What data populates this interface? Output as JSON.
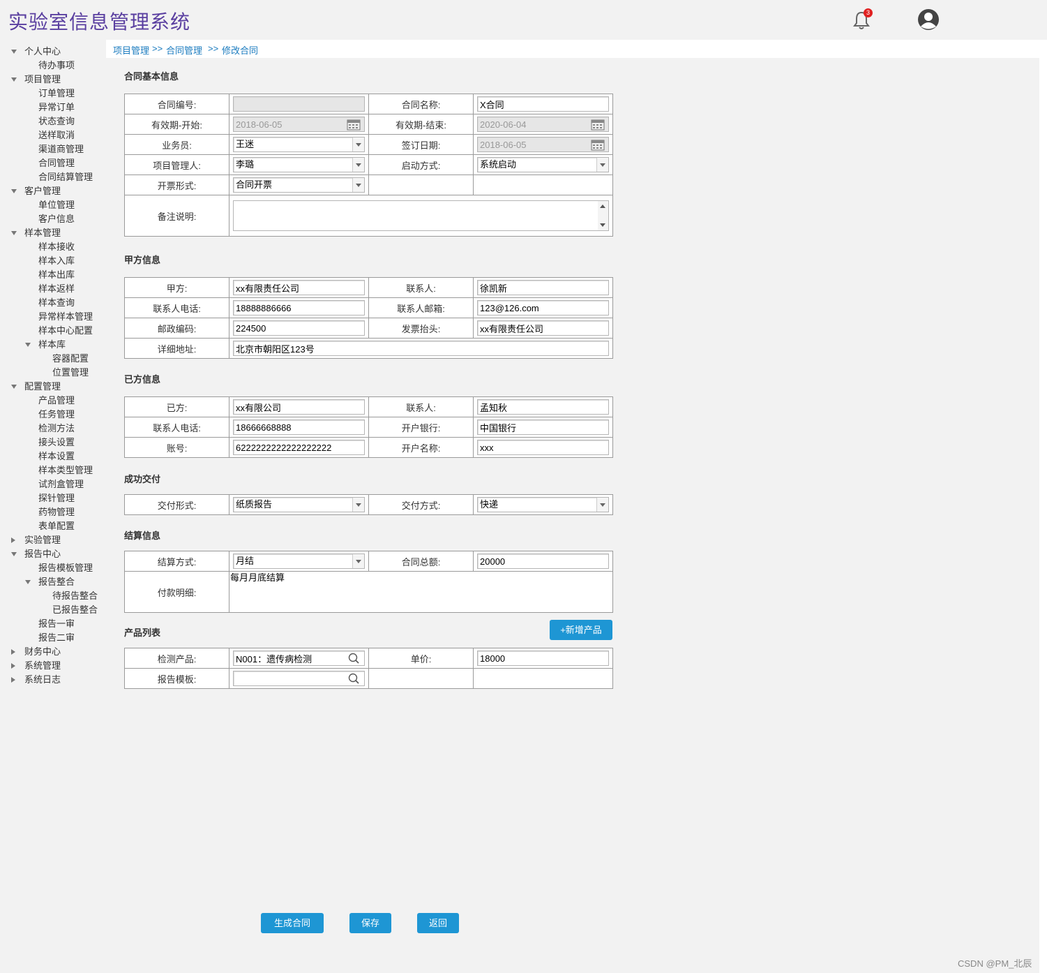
{
  "header": {
    "app_title": "实验室信息管理系统",
    "notification_count": "3"
  },
  "breadcrumb": {
    "items": [
      "项目管理",
      "合同管理",
      "修改合同"
    ],
    "separator": ">>"
  },
  "sidebar": {
    "items": [
      {
        "label": "个人中心",
        "level": 0,
        "state": "expanded"
      },
      {
        "label": "待办事项",
        "level": 1
      },
      {
        "label": "项目管理",
        "level": 0,
        "state": "expanded"
      },
      {
        "label": "订单管理",
        "level": 1
      },
      {
        "label": "异常订单",
        "level": 1
      },
      {
        "label": "状态查询",
        "level": 1
      },
      {
        "label": "送样取消",
        "level": 1
      },
      {
        "label": "渠道商管理",
        "level": 1
      },
      {
        "label": "合同管理",
        "level": 1
      },
      {
        "label": "合同结算管理",
        "level": 1
      },
      {
        "label": "客户管理",
        "level": 0,
        "state": "expanded"
      },
      {
        "label": "单位管理",
        "level": 1
      },
      {
        "label": "客户信息",
        "level": 1
      },
      {
        "label": "样本管理",
        "level": 0,
        "state": "expanded"
      },
      {
        "label": "样本接收",
        "level": 1
      },
      {
        "label": "样本入库",
        "level": 1
      },
      {
        "label": "样本出库",
        "level": 1
      },
      {
        "label": "样本返样",
        "level": 1
      },
      {
        "label": "样本查询",
        "level": 1
      },
      {
        "label": "异常样本管理",
        "level": 1
      },
      {
        "label": "样本中心配置",
        "level": 1
      },
      {
        "label": "样本库",
        "level": 1,
        "state": "expanded"
      },
      {
        "label": "容器配置",
        "level": 2
      },
      {
        "label": "位置管理",
        "level": 2
      },
      {
        "label": "配置管理",
        "level": 0,
        "state": "expanded"
      },
      {
        "label": "产品管理",
        "level": 1
      },
      {
        "label": "任务管理",
        "level": 1
      },
      {
        "label": "检测方法",
        "level": 1
      },
      {
        "label": "接头设置",
        "level": 1
      },
      {
        "label": "样本设置",
        "level": 1
      },
      {
        "label": "样本类型管理",
        "level": 1
      },
      {
        "label": "试剂盒管理",
        "level": 1
      },
      {
        "label": "探针管理",
        "level": 1
      },
      {
        "label": "药物管理",
        "level": 1
      },
      {
        "label": "表单配置",
        "level": 1
      },
      {
        "label": "实验管理",
        "level": 0,
        "state": "collapsed"
      },
      {
        "label": "报告中心",
        "level": 0,
        "state": "expanded"
      },
      {
        "label": "报告模板管理",
        "level": 1
      },
      {
        "label": "报告整合",
        "level": 1,
        "state": "expanded"
      },
      {
        "label": "待报告整合",
        "level": 2
      },
      {
        "label": "已报告整合",
        "level": 2
      },
      {
        "label": "报告一审",
        "level": 1
      },
      {
        "label": "报告二审",
        "level": 1
      },
      {
        "label": "财务中心",
        "level": 0,
        "state": "collapsed"
      },
      {
        "label": "系统管理",
        "level": 0,
        "state": "collapsed"
      },
      {
        "label": "系统日志",
        "level": 0,
        "state": "collapsed"
      }
    ]
  },
  "sections": {
    "basic": "合同基本信息",
    "party_a": "甲方信息",
    "party_b": "已方信息",
    "delivery": "成功交付",
    "settlement": "结算信息",
    "products": "产品列表"
  },
  "basic": {
    "contract_no_label": "合同编号:",
    "contract_no": "",
    "contract_name_label": "合同名称:",
    "contract_name": "X合同",
    "valid_start_label": "有效期-开始:",
    "valid_start": "2018-06-05",
    "valid_end_label": "有效期-结束:",
    "valid_end": "2020-06-04",
    "salesman_label": "业务员:",
    "salesman": "王迷",
    "sign_date_label": "签订日期:",
    "sign_date": "2018-06-05",
    "pm_label": "项目管理人:",
    "pm": "李璐",
    "start_mode_label": "启动方式:",
    "start_mode": "系统启动",
    "invoice_form_label": "开票形式:",
    "invoice_form": "合同开票",
    "remark_label": "备注说明:",
    "remark": ""
  },
  "party_a": {
    "party_label": "甲方:",
    "party": "xx有限责任公司",
    "contact_label": "联系人:",
    "contact": "徐凯新",
    "phone_label": "联系人电话:",
    "phone": "18888886666",
    "email_label": "联系人邮箱:",
    "email": "123@126.com",
    "zip_label": "邮政编码:",
    "zip": "224500",
    "invoice_title_label": "发票抬头:",
    "invoice_title": "xx有限责任公司",
    "address_label": "详细地址:",
    "address": "北京市朝阳区123号"
  },
  "party_b": {
    "party_label": "已方:",
    "party": "xx有限公司",
    "contact_label": "联系人:",
    "contact": "孟知秋",
    "phone_label": "联系人电话:",
    "phone": "18666668888",
    "bank_label": "开户银行:",
    "bank": "中国银行",
    "account_label": "账号:",
    "account": "6222222222222222222",
    "account_name_label": "开户名称:",
    "account_name": "xxx"
  },
  "delivery": {
    "form_label": "交付形式:",
    "form": "纸质报告",
    "mode_label": "交付方式:",
    "mode": "快递"
  },
  "settlement": {
    "method_label": "结算方式:",
    "method": "月结",
    "total_label": "合同总额:",
    "total": "20000",
    "detail_label": "付款明细:",
    "detail": "每月月底结算"
  },
  "products": {
    "add_button": "+新增产品",
    "product_label": "检测产品:",
    "product": "N001：遗传病检测",
    "price_label": "单价:",
    "price": "18000",
    "template_label": "报告模板:",
    "template": ""
  },
  "actions": {
    "generate": "生成合同",
    "save": "保存",
    "back": "返回"
  },
  "watermark": "CSDN @PM_北辰",
  "colors": {
    "title": "#5a3fa0",
    "link": "#1a7bbf",
    "button": "#1e96d4",
    "badge": "#e02020"
  }
}
